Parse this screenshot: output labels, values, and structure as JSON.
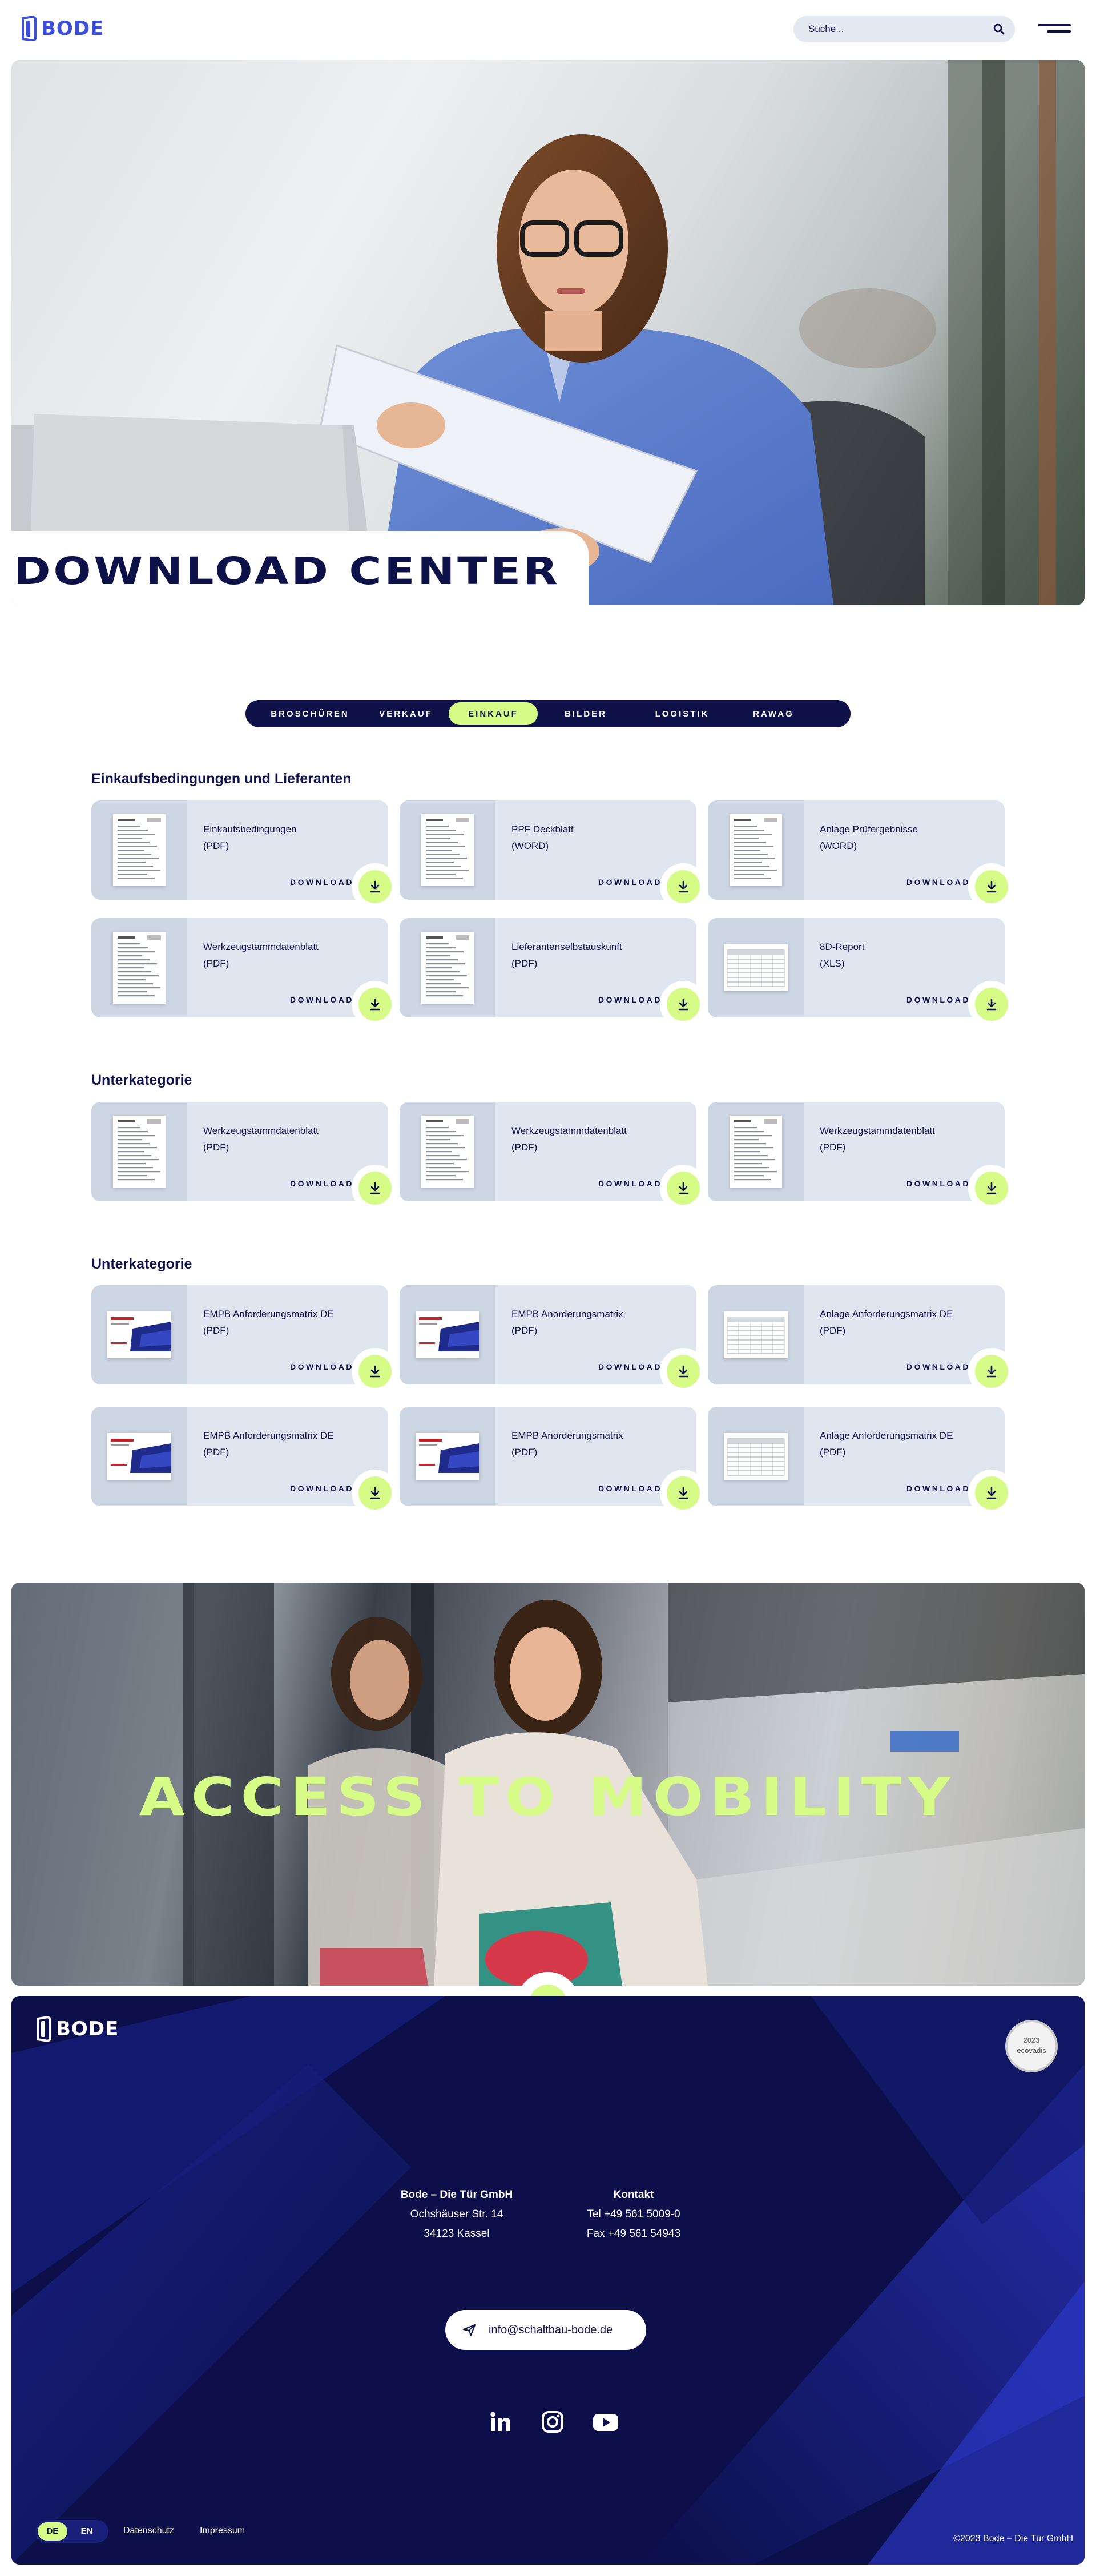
{
  "brand": {
    "name": "BODE",
    "accent": "#3d4fd8",
    "navy": "#0e1248",
    "lime": "#d6fb86"
  },
  "header": {
    "search_placeholder": "Suche...",
    "search_icon": "search-icon",
    "menu_icon": "hamburger-menu-icon"
  },
  "hero": {
    "title": "DOWNLOAD CENTER"
  },
  "tabs": [
    {
      "label": "BROSCHÜREN",
      "active": false
    },
    {
      "label": "VERKAUF",
      "active": false
    },
    {
      "label": "EINKAUF",
      "active": true
    },
    {
      "label": "BILDER",
      "active": false
    },
    {
      "label": "LOGISTIK",
      "active": false
    },
    {
      "label": "RAWAG",
      "active": false
    }
  ],
  "sections": [
    {
      "title": "Einkaufsbedingungen und Lieferanten"
    },
    {
      "title": "Unterkategorie"
    },
    {
      "title": "Unterkategorie"
    }
  ],
  "cards": [
    {
      "label": "Einkaufsbedingungen\n(PDF)",
      "download": "DOWNLOAD"
    },
    {
      "label": "PPF Deckblatt\n(WORD)",
      "download": "DOWNLOAD"
    },
    {
      "label": "Anlage Prüfergebnisse\n(WORD)",
      "download": "DOWNLOAD"
    },
    {
      "label": "Werkzeugstammdatenblatt\n(PDF)",
      "download": "DOWNLOAD"
    },
    {
      "label": "Lieferantenselbstauskunft\n(PDF)",
      "download": "DOWNLOAD"
    },
    {
      "label": "8D-Report\n(XLS)",
      "download": "DOWNLOAD"
    },
    {
      "label": "Werkzeugstammdatenblatt\n(PDF)",
      "download": "DOWNLOAD"
    },
    {
      "label": "Werkzeugstammdatenblatt\n(PDF)",
      "download": "DOWNLOAD"
    },
    {
      "label": "Werkzeugstammdatenblatt\n(PDF)",
      "download": "DOWNLOAD"
    },
    {
      "label": "EMPB Anforderungsmatrix DE\n(PDF)",
      "download": "DOWNLOAD"
    },
    {
      "label": "EMPB Anorderungsmatrix\n(PDF)",
      "download": "DOWNLOAD"
    },
    {
      "label": "Anlage Anforderungsmatrix DE\n(PDF)",
      "download": "DOWNLOAD"
    },
    {
      "label": "EMPB Anforderungsmatrix DE\n(PDF)",
      "download": "DOWNLOAD"
    },
    {
      "label": "EMPB Anorderungsmatrix\n(PDF)",
      "download": "DOWNLOAD"
    },
    {
      "label": "Anlage Anforderungsmatrix DE\n(PDF)",
      "download": "DOWNLOAD"
    }
  ],
  "banner": {
    "title": "ACCESS TO MOBILITY"
  },
  "footer": {
    "company": "Bode – Die Tür GmbH",
    "street": "Ochshäuser Str. 14",
    "city": "34123 Kassel",
    "contact_head": "Kontakt",
    "tel": "Tel +49 561 5009-0",
    "fax": "Fax  +49 561 54943",
    "email": "info@schaltbau-bode.de",
    "ecovadis_year": "2023",
    "ecovadis_name": "ecovadis",
    "social": [
      "linkedin-icon",
      "instagram-icon",
      "youtube-icon"
    ],
    "lang": [
      {
        "label": "DE",
        "active": true
      },
      {
        "label": "EN",
        "active": false
      }
    ],
    "datenschutz": "Datenschutz",
    "impressum": "Impressum",
    "copyright": "©2023 Bode – Die Tür GmbH"
  }
}
